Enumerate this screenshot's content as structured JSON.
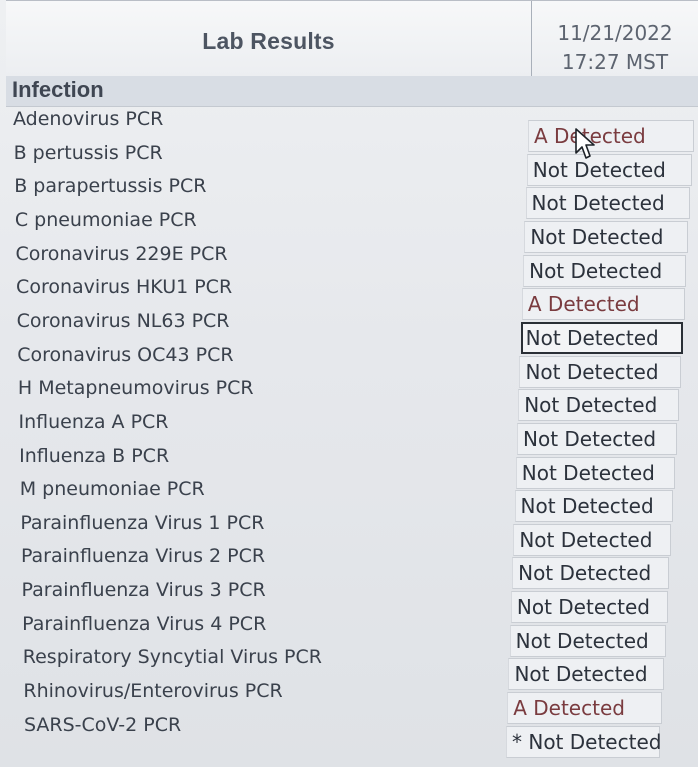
{
  "header": {
    "title": "Lab Results",
    "date": "11/21/2022",
    "time": "17:27 MST"
  },
  "section": {
    "label": "Infection"
  },
  "results": [
    {
      "name": "Adenovirus PCR",
      "result": "A Detected",
      "status": "detected"
    },
    {
      "name": "B pertussis PCR",
      "result": "Not Detected",
      "status": "normal"
    },
    {
      "name": "B parapertussis PCR",
      "result": "Not Detected",
      "status": "normal"
    },
    {
      "name": "C pneumoniae PCR",
      "result": "Not Detected",
      "status": "normal"
    },
    {
      "name": "Coronavirus 229E PCR",
      "result": "Not Detected",
      "status": "normal"
    },
    {
      "name": "Coronavirus HKU1 PCR",
      "result": "A Detected",
      "status": "detected"
    },
    {
      "name": "Coronavirus NL63 PCR",
      "result": "Not Detected",
      "status": "selected"
    },
    {
      "name": "Coronavirus OC43 PCR",
      "result": "Not Detected",
      "status": "normal"
    },
    {
      "name": "H Metapneumovirus PCR",
      "result": "Not Detected",
      "status": "normal"
    },
    {
      "name": "Influenza A PCR",
      "result": "Not Detected",
      "status": "normal"
    },
    {
      "name": "Influenza B PCR",
      "result": "Not Detected",
      "status": "normal"
    },
    {
      "name": "M pneumoniae PCR",
      "result": "Not Detected",
      "status": "normal"
    },
    {
      "name": "Parainfluenza Virus 1 PCR",
      "result": "Not Detected",
      "status": "normal"
    },
    {
      "name": "Parainfluenza Virus 2 PCR",
      "result": "Not Detected",
      "status": "normal"
    },
    {
      "name": "Parainfluenza Virus 3 PCR",
      "result": "Not Detected",
      "status": "normal"
    },
    {
      "name": "Parainfluenza Virus 4 PCR",
      "result": "Not Detected",
      "status": "normal"
    },
    {
      "name": "Respiratory Syncytial Virus PCR",
      "result": "Not Detected",
      "status": "normal"
    },
    {
      "name": "Rhinovirus/Enterovirus PCR",
      "result": "A Detected",
      "status": "detected"
    },
    {
      "name": "SARS-CoV-2 PCR",
      "result": "* Not Detected",
      "status": "normal"
    }
  ],
  "cursor": {
    "icon": "mouse-pointer-icon"
  },
  "colors": {
    "detected_text": "#7a3b3f",
    "normal_text": "#2c323c",
    "section_bg": "#d8dde4"
  }
}
